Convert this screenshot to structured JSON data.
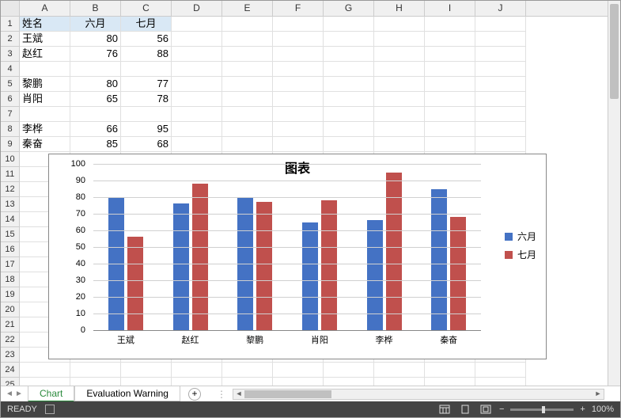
{
  "columns": [
    "A",
    "B",
    "C",
    "D",
    "E",
    "F",
    "G",
    "H",
    "I",
    "J"
  ],
  "row_count": 25,
  "header_row": {
    "a": "姓名",
    "b": "六月",
    "c": "七月"
  },
  "data_rows": [
    {
      "r": 2,
      "a": "王斌",
      "b": "80",
      "c": "56"
    },
    {
      "r": 3,
      "a": "赵红",
      "b": "76",
      "c": "88"
    },
    {
      "r": 5,
      "a": "黎鹏",
      "b": "80",
      "c": "77"
    },
    {
      "r": 6,
      "a": "肖阳",
      "b": "65",
      "c": "78"
    },
    {
      "r": 8,
      "a": "李桦",
      "b": "66",
      "c": "95"
    },
    {
      "r": 9,
      "a": "秦奋",
      "b": "85",
      "c": "68"
    }
  ],
  "chart_data": {
    "type": "bar",
    "title": "图表",
    "categories": [
      "王斌",
      "赵红",
      "黎鹏",
      "肖阳",
      "李桦",
      "秦奋"
    ],
    "series": [
      {
        "name": "六月",
        "color": "#4472C4",
        "values": [
          80,
          76,
          80,
          65,
          66,
          85
        ]
      },
      {
        "name": "七月",
        "color": "#C0504D",
        "values": [
          56,
          88,
          77,
          78,
          95,
          68
        ]
      }
    ],
    "ylim": [
      0,
      100
    ],
    "ytick": 10
  },
  "sheets": {
    "active": "Chart",
    "tabs": [
      "Chart",
      "Evaluation Warning"
    ]
  },
  "status": {
    "ready": "READY",
    "zoom": "100%",
    "zoom_minus": "−",
    "zoom_plus": "+"
  }
}
